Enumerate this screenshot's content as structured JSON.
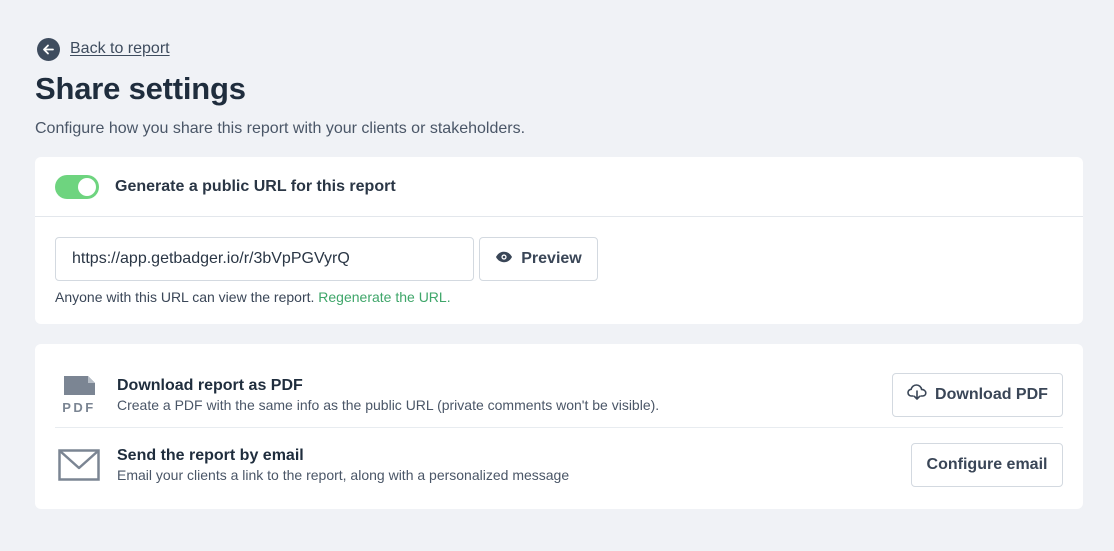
{
  "back_link": {
    "label": "Back to report",
    "icon": "arrow-left-icon"
  },
  "page": {
    "title": "Share settings",
    "subtitle": "Configure how you share this report with your clients or stakeholders."
  },
  "public_url": {
    "toggle_label": "Generate a public URL for this report",
    "toggle_on": true,
    "url_value": "https://app.getbadger.io/r/3bVpPGVyrQ",
    "preview_label": "Preview",
    "help_text": "Anyone with this URL can view the report.",
    "regenerate_label": "Regenerate the URL."
  },
  "actions": {
    "pdf": {
      "title": "Download report as PDF",
      "description": "Create a PDF with the same info as the public URL (private comments won't be visible).",
      "button_label": "Download PDF",
      "icon_text": "PDF"
    },
    "email": {
      "title": "Send the report by email",
      "description": "Email your clients a link to the report, along with a personalized message",
      "button_label": "Configure email"
    }
  },
  "colors": {
    "toggle_on": "#6ed47f",
    "link_green": "#3fa66a",
    "heading": "#1f2d3d",
    "background": "#f0f2f6"
  }
}
